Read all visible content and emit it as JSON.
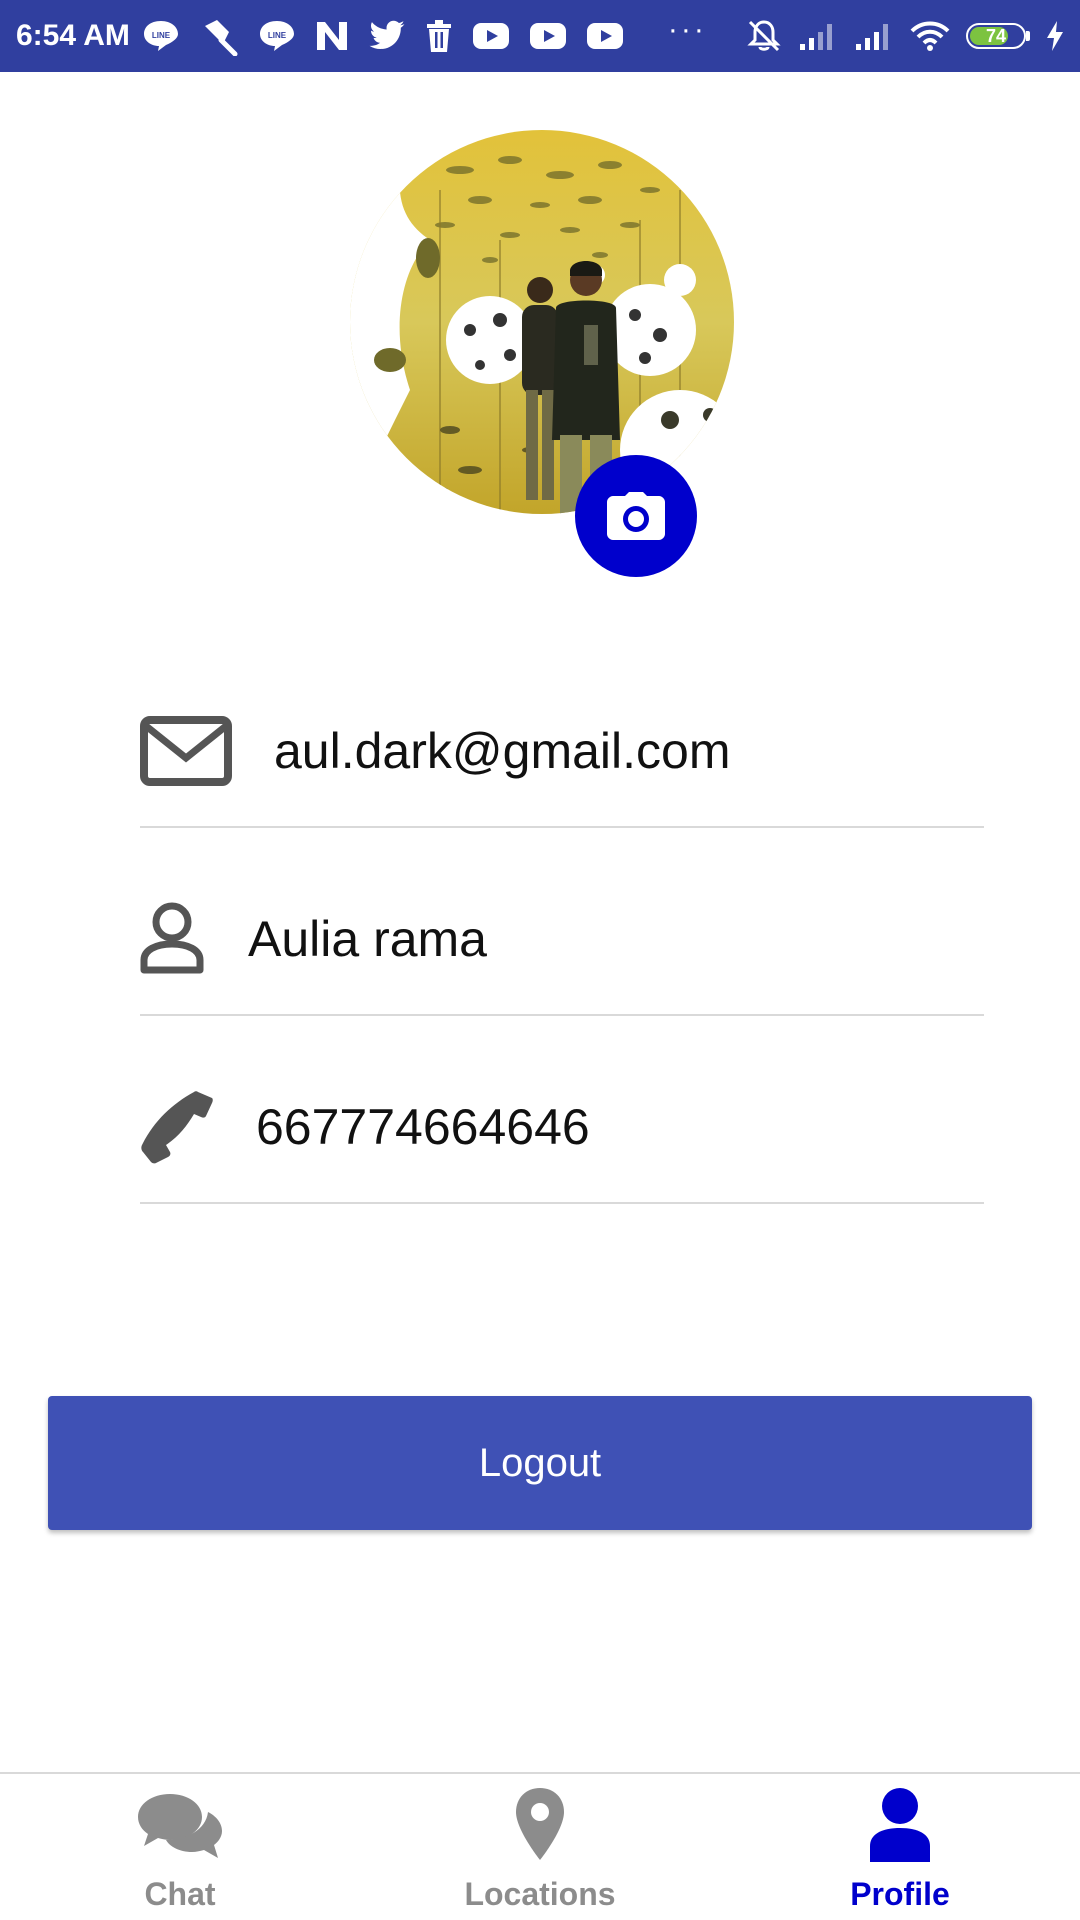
{
  "status_bar": {
    "time": "6:54 AM",
    "notification_icons": [
      "line-icon",
      "pin-icon",
      "line-icon",
      "n-icon",
      "twitter-icon",
      "trash-icon",
      "youtube-icon",
      "youtube-icon",
      "youtube-icon"
    ],
    "overflow": "···",
    "battery_level": "74",
    "battery_fraction": 0.74,
    "colors": {
      "background": "#303f9f",
      "battery_fill": "#7cc340"
    }
  },
  "profile": {
    "email": "aul.dark@gmail.com",
    "name": "Aulia rama",
    "phone": "667774664646",
    "camera_icon": "camera-icon",
    "colors": {
      "camera_button": "#0000cc",
      "field_icon": "#555555"
    }
  },
  "logout": {
    "label": "Logout",
    "color": "#3f51b5"
  },
  "bottom_nav": {
    "items": [
      {
        "label": "Chat",
        "icon": "chat-bubbles-icon",
        "active": false
      },
      {
        "label": "Locations",
        "icon": "map-pin-icon",
        "active": false
      },
      {
        "label": "Profile",
        "icon": "person-icon",
        "active": true
      }
    ],
    "colors": {
      "active": "#0000cc",
      "inactive": "#8c8c8c"
    }
  }
}
